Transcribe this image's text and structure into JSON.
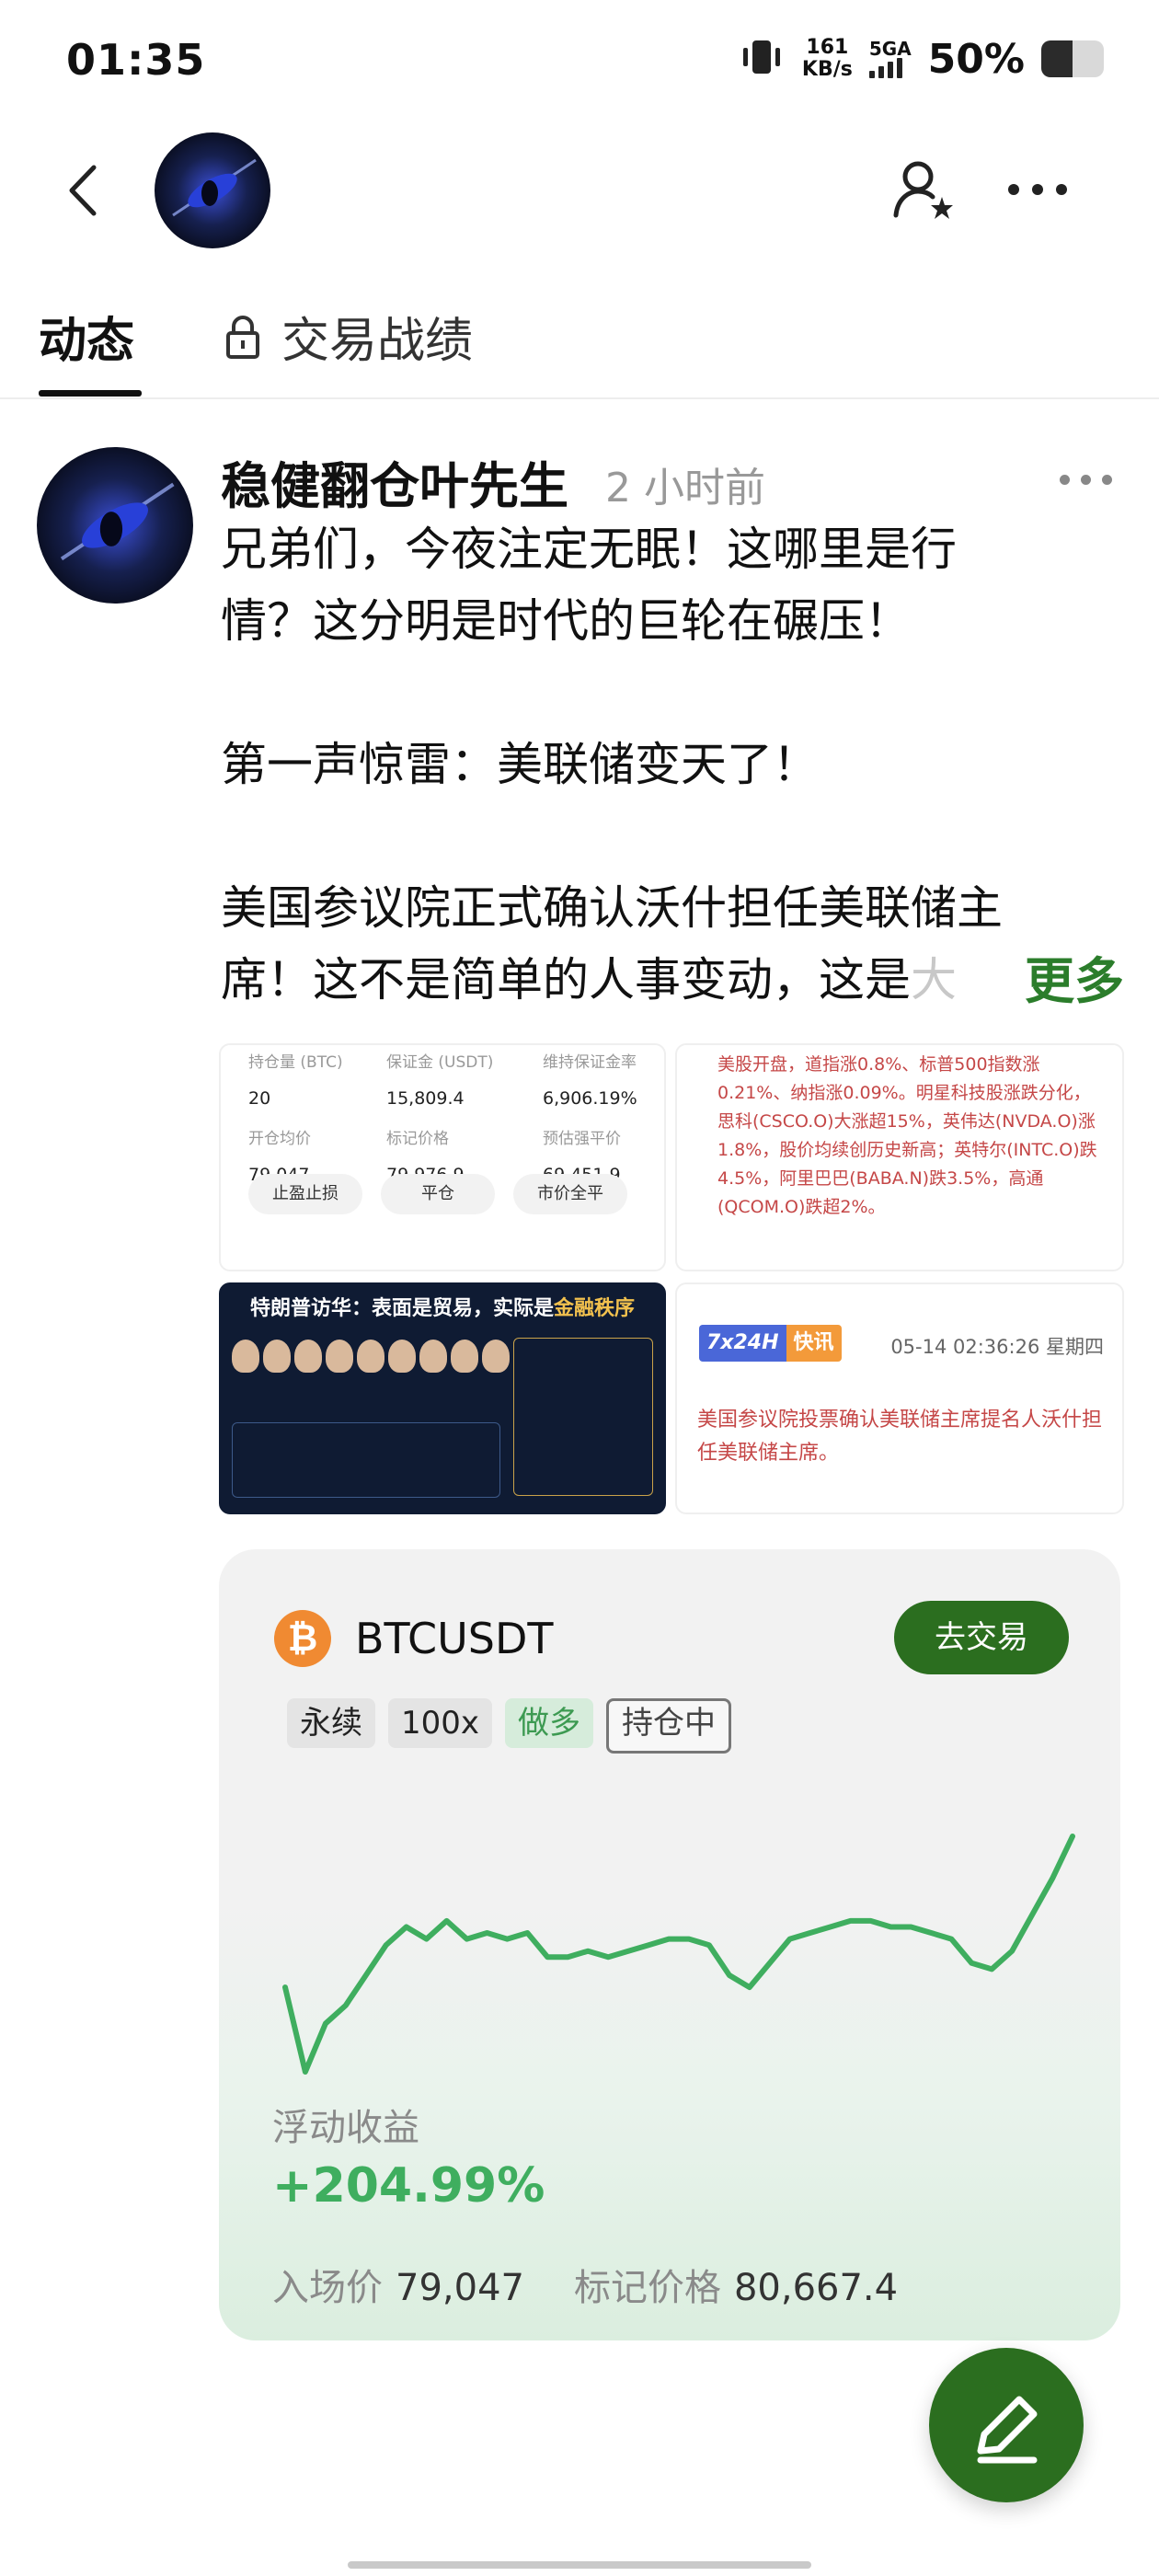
{
  "status_bar": {
    "time": "01:35",
    "net_speed_value": "161",
    "net_speed_unit": "KB/s",
    "network": "5GA",
    "battery_text": "50%",
    "battery_level": 0.5
  },
  "tabs": [
    {
      "label": "动态",
      "active": true
    },
    {
      "label": "交易战绩",
      "locked": true
    }
  ],
  "post": {
    "author": "稳健翻仓叶先生",
    "time": "2 小时前",
    "lines": [
      "兄弟们，今夜注定无眠！这哪里是行",
      "情？这分明是时代的巨轮在碾压！",
      "",
      "第一声惊雷：美联储变天了！",
      "",
      "美国参议院正式确认沃什担任美联储主"
    ],
    "last_line_visible": "席！这不是简单的人事变动，这是",
    "last_line_faded": "大",
    "more": "更多"
  },
  "thumbnails": {
    "position": {
      "labels": [
        "持仓量 (BTC)",
        "保证金 (USDT)",
        "维持保证金率",
        "开仓均价",
        "标记价格",
        "预估强平价"
      ],
      "values": [
        "20",
        "15,809.4",
        "6,906.19%",
        "79,047",
        "79,976.9",
        "69,451.9"
      ],
      "buttons": [
        "止盈止损",
        "平仓",
        "市价全平"
      ]
    },
    "market_news": "美股开盘，道指涨0.8%、标普500指数涨0.21%、纳指涨0.09%。明星科技股涨跌分化，思科(CSCO.O)大涨超15%，英伟达(NVDA.O)涨1.8%，股价均续创历史新高；英特尔(INTC.O)跌4.5%，阿里巴巴(BABA.N)跌3.5%，高通(QCOM.O)跌超2%。",
    "infographic": {
      "title_prefix": "特朗普访华：表面是贸易，实际是",
      "title_highlight": "金融秩序"
    },
    "flash": {
      "badge_a": "7x24H",
      "badge_b": "快讯",
      "date": "05-14 02:36:26 星期四",
      "text": "美国参议院投票确认美联储主席提名人沃什担任美联储主席。"
    }
  },
  "trade_card": {
    "coin_icon": "bitcoin-icon",
    "coin_glyph": "₿",
    "symbol": "BTCUSDT",
    "go_trade": "去交易",
    "tags": [
      "永续",
      "100x",
      "做多",
      "持仓中"
    ],
    "pnl_label": "浮动收益",
    "pnl_value": "+204.99%",
    "entry_label": "入场价",
    "entry_value": "79,047",
    "mark_label": "标记价格",
    "mark_value": "80,667.4",
    "accent": "#2b6e1f",
    "profit_color": "#3fae5f"
  },
  "chart_data": {
    "type": "line",
    "series": [
      {
        "values": [
          50,
          36,
          44,
          47,
          52,
          57,
          60,
          58,
          61,
          58,
          59,
          58,
          59,
          55,
          55,
          56,
          55,
          56,
          57,
          58,
          58,
          57,
          52,
          50,
          54,
          58,
          59,
          60,
          61,
          61,
          60,
          60,
          59,
          58,
          54,
          53,
          56,
          62,
          68,
          75
        ]
      }
    ]
  }
}
